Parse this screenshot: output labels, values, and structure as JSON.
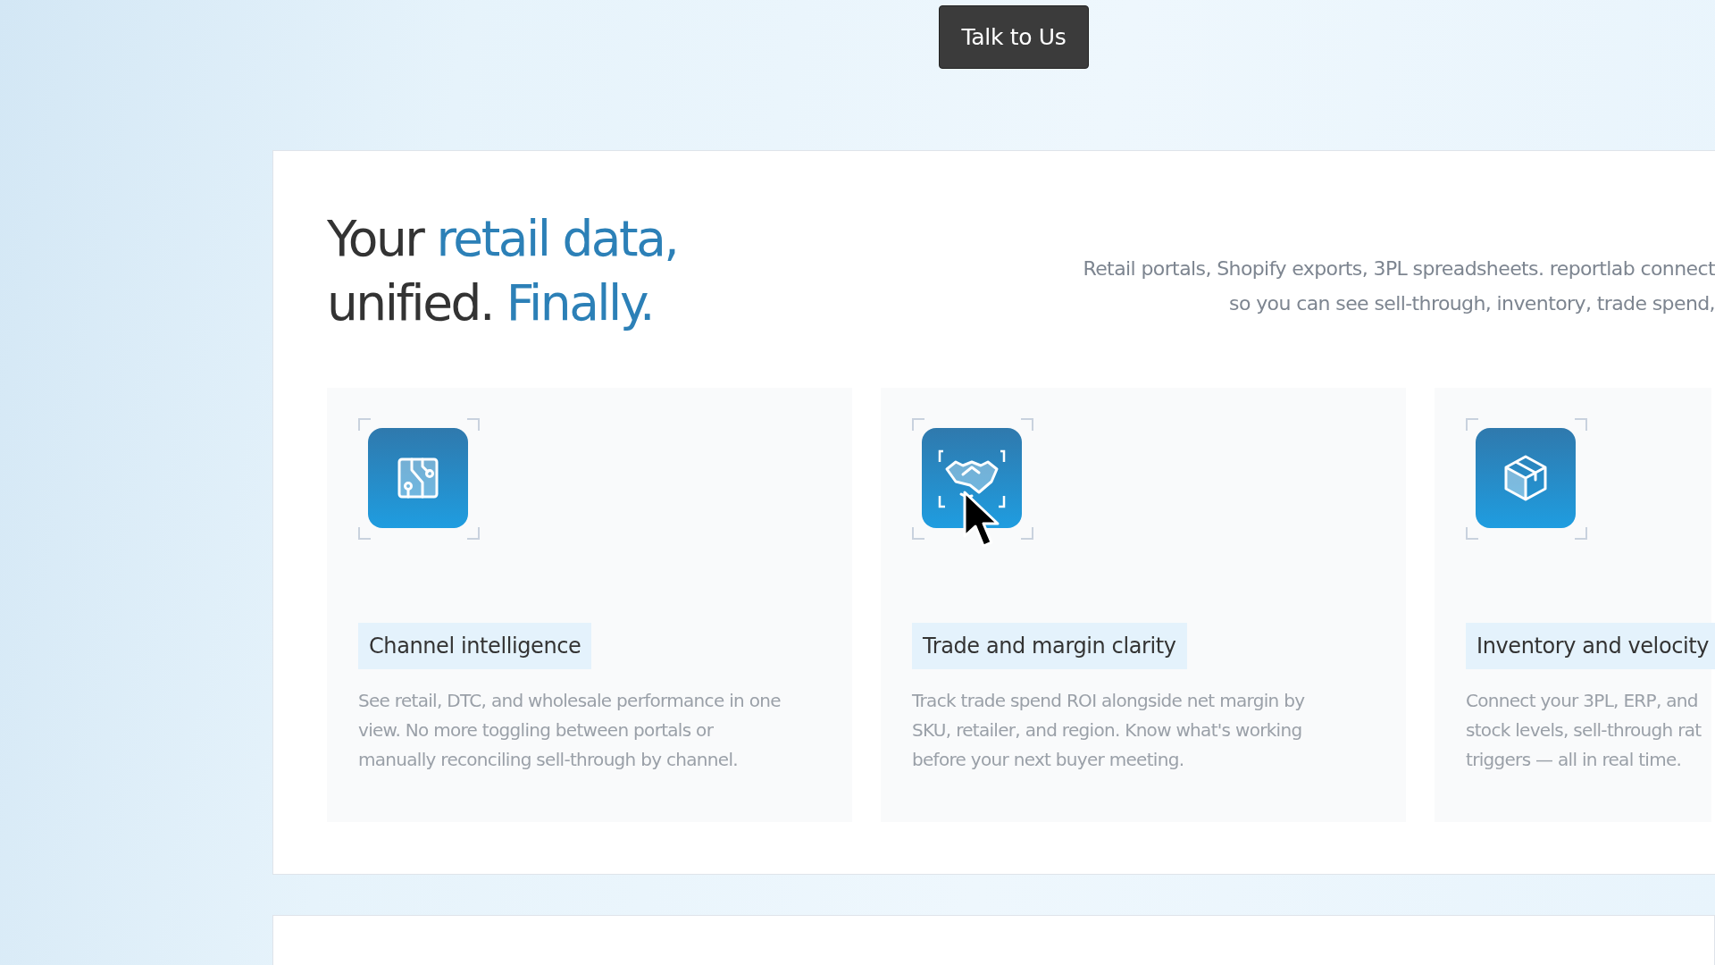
{
  "cta_button": {
    "label": "Talk to Us"
  },
  "heading": {
    "lines": [
      "Your **retail data,**",
      "unified. **Finally.**"
    ]
  },
  "intro": {
    "lines": [
      "Retail portals, Shopify exports, 3PL spreadsheets. reportlab connect",
      "so you can see sell-through, inventory, trade spend,"
    ]
  },
  "features": [
    {
      "title": "Channel intelligence",
      "lines": [
        "See retail, DTC, and wholesale performance in one",
        "view. No more toggling between portals or",
        "manually reconciling sell-through by channel."
      ]
    },
    {
      "title": "Trade and margin clarity",
      "lines": [
        "Track trade spend ROI alongside net margin by",
        "SKU, retailer, and region. Know what's working",
        "before your next buyer meeting."
      ]
    },
    {
      "title": "Inventory and velocity",
      "lines": [
        "Connect your 3PL, ERP, and",
        "stock levels, sell-through rat",
        "triggers — all in real time."
      ]
    }
  ]
}
